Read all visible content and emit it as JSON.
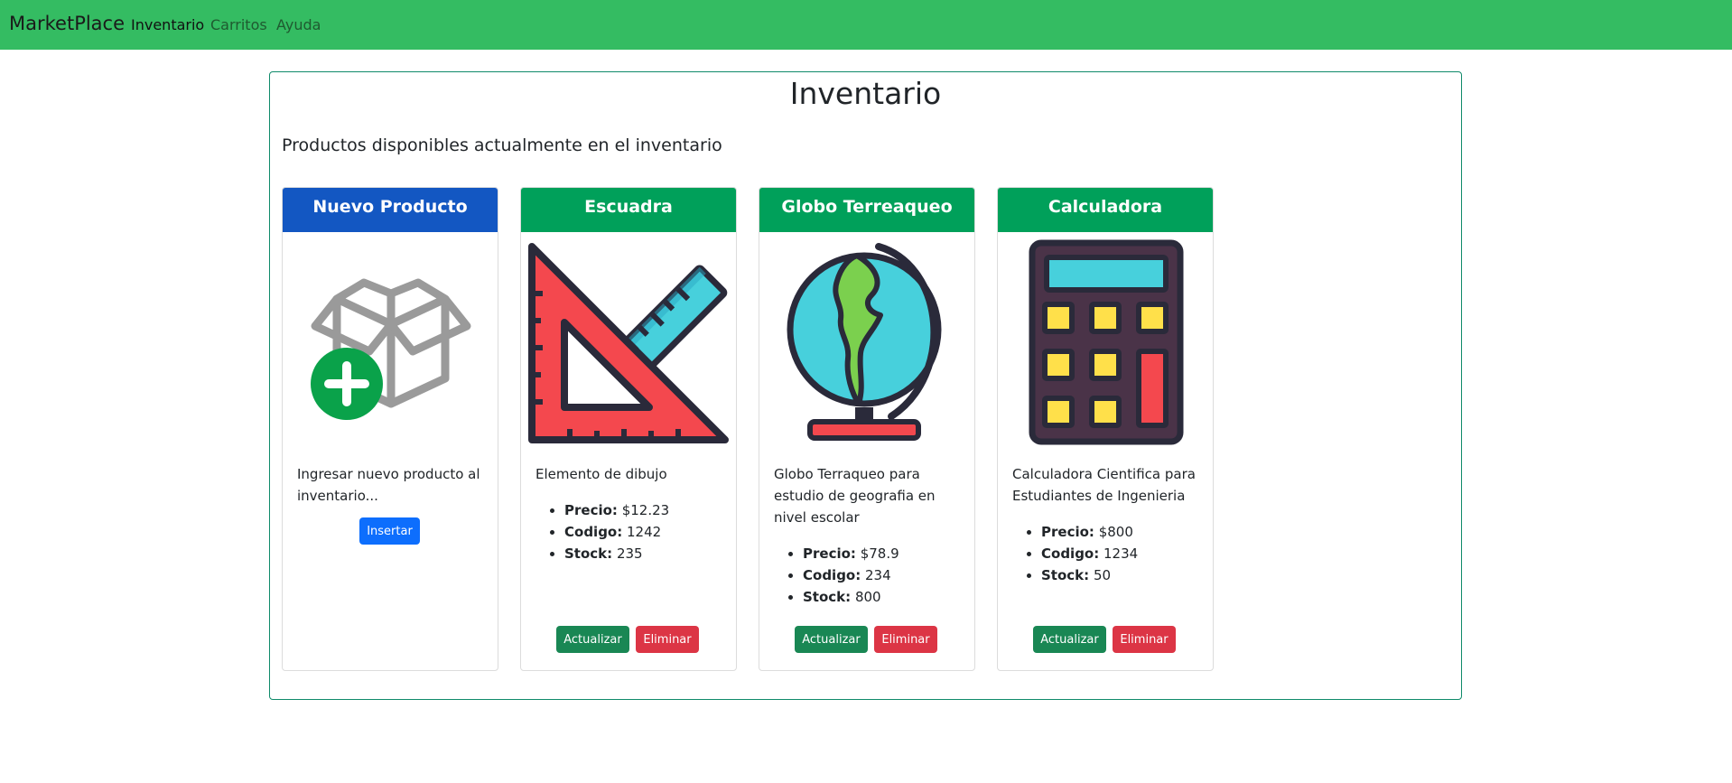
{
  "nav": {
    "brand": "MarketPlace",
    "links": [
      {
        "label": "Inventario",
        "active": true
      },
      {
        "label": "Carritos",
        "active": false
      },
      {
        "label": "Ayuda",
        "active": false
      }
    ]
  },
  "panel": {
    "title": "Inventario",
    "subtitle": "Productos disponibles actualmente en el inventario"
  },
  "new_card": {
    "title": "Nuevo Producto",
    "icon": "box-plus-icon",
    "description": "Ingresar nuevo producto al inventario...",
    "insert_label": "Insertar"
  },
  "products": [
    {
      "title": "Escuadra",
      "icon": "set-square-ruler-icon",
      "description": "Elemento de dibujo",
      "price_label": "Precio:",
      "price": "$12.23",
      "code_label": "Codigo:",
      "code": "1242",
      "stock_label": "Stock:",
      "stock": "235",
      "update_label": "Actualizar",
      "delete_label": "Eliminar"
    },
    {
      "title": "Globo Terreaqueo",
      "icon": "globe-icon",
      "description": "Globo Terraqueo para estudio de geografia en nivel escolar",
      "price_label": "Precio:",
      "price": "$78.9",
      "code_label": "Codigo:",
      "code": "234",
      "stock_label": "Stock:",
      "stock": "800",
      "update_label": "Actualizar",
      "delete_label": "Eliminar"
    },
    {
      "title": "Calculadora",
      "icon": "calculator-icon",
      "description": "Calculadora Cientifica para Estudiantes de Ingenieria",
      "price_label": "Precio:",
      "price": "$800",
      "code_label": "Codigo:",
      "code": "1234",
      "stock_label": "Stock:",
      "stock": "50",
      "update_label": "Actualizar",
      "delete_label": "Eliminar"
    }
  ],
  "colors": {
    "navbar": "#34bc62",
    "header_new": "#1357c2",
    "header_product": "#00a05a",
    "btn_primary": "#0d6efd",
    "btn_success": "#198754",
    "btn_danger": "#dc3545"
  }
}
